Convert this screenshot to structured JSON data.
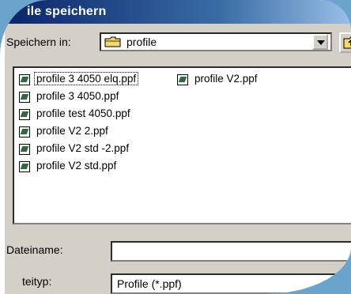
{
  "dialog": {
    "title": "Datei speichern",
    "title_visible": "ile speichern"
  },
  "save_in": {
    "label": "Speichern in:",
    "value": "profile"
  },
  "files": [
    "profile 3 4050 elq.ppf",
    "profile 3 4050.ppf",
    "profile test 4050.ppf",
    "profile V2 2.ppf",
    "profile V2 std -2.ppf",
    "profile V2 std.ppf",
    "profile V2.ppf"
  ],
  "filename": {
    "label": "Dateiname:",
    "value": ""
  },
  "filetype": {
    "label": "Dateityp:",
    "label_visible": "teityp:",
    "value": "Profile (*.ppf)"
  }
}
